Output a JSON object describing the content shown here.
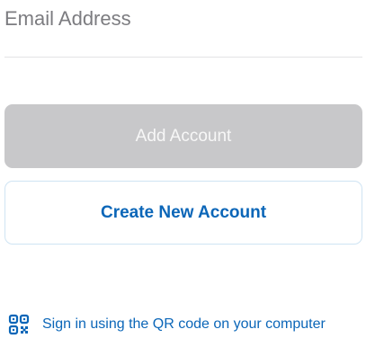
{
  "email": {
    "placeholder": "Email Address",
    "value": ""
  },
  "buttons": {
    "add_account": "Add Account",
    "create_new_account": "Create New Account"
  },
  "qr_signin": {
    "icon": "qr-code-icon",
    "label": "Sign in using the QR code on your computer"
  },
  "colors": {
    "accent": "#0b66b8",
    "disabled_button": "#c8c8ca",
    "create_border": "#cfe4f3"
  }
}
